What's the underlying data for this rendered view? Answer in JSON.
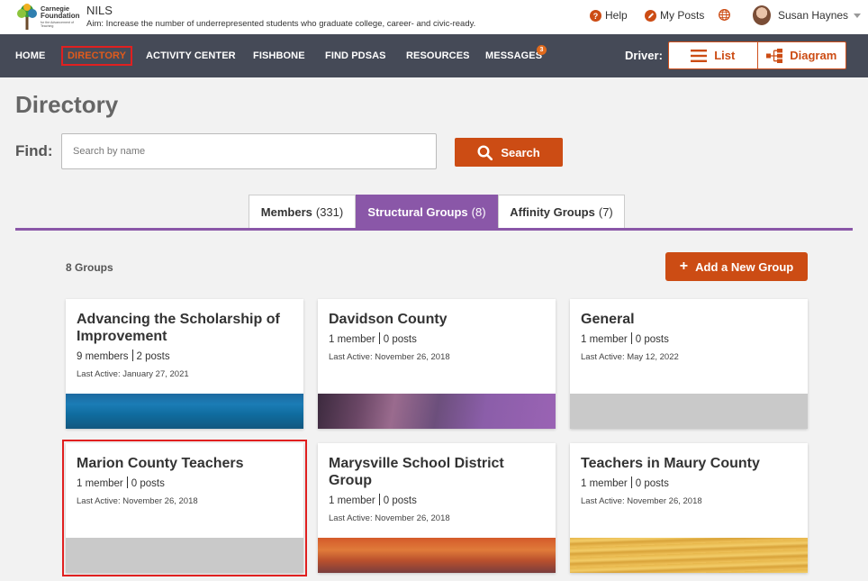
{
  "header": {
    "logo_line1": "Carnegie",
    "logo_line2": "Foundation",
    "logo_line3": "for the Advancement of Teaching",
    "app_name": "NILS",
    "aim": "Aim: Increase the number of underrepresented students who graduate college, career- and civic-ready.",
    "help": "Help",
    "my_posts": "My Posts",
    "user_name": "Susan Haynes"
  },
  "nav": {
    "items": [
      "HOME",
      "DIRECTORY",
      "ACTIVITY CENTER",
      "FISHBONE",
      "FIND PDSAS",
      "RESOURCES",
      "MESSAGES"
    ],
    "active": "DIRECTORY",
    "messages_badge": "3",
    "driver_label": "Driver:",
    "driver_list": "List",
    "driver_diagram": "Diagram"
  },
  "directory": {
    "title": "Directory",
    "find_label": "Find:",
    "search_placeholder": "Search by name",
    "search_value": "",
    "search_button": "Search",
    "tabs": [
      {
        "label": "Members",
        "count": "(331)"
      },
      {
        "label": "Structural Groups",
        "count": "(8)"
      },
      {
        "label": "Affinity Groups",
        "count": "(7)"
      }
    ],
    "active_tab": "Structural Groups",
    "groups_count": "8 Groups",
    "add_group_button": "Add a New Group"
  },
  "groups": [
    {
      "title": "Advancing the Scholarship of Improvement",
      "members": "9 members",
      "posts": "2 posts",
      "last_active": "Last Active: January 27, 2021",
      "image": "blue"
    },
    {
      "title": "Davidson County",
      "members": "1 member",
      "posts": "0 posts",
      "last_active": "Last Active: November 26, 2018",
      "image": "purple"
    },
    {
      "title": "General",
      "members": "1 member",
      "posts": "0 posts",
      "last_active": "Last Active: May 12, 2022",
      "image": "gray"
    },
    {
      "title": "Marion County Teachers",
      "members": "1 member",
      "posts": "0 posts",
      "last_active": "Last Active: November 26, 2018",
      "image": "gray"
    },
    {
      "title": "Marysville School District Group",
      "members": "1 member",
      "posts": "0 posts",
      "last_active": "Last Active: November 26, 2018",
      "image": "orange"
    },
    {
      "title": "Teachers in Maury County",
      "members": "1 member",
      "posts": "0 posts",
      "last_active": "Last Active: November 26, 2018",
      "image": "wood"
    }
  ],
  "colors": {
    "accent_orange": "#cc4c14",
    "nav_bg": "#454a57",
    "tab_purple": "#8a57a8",
    "highlight_red": "#e02020"
  },
  "icons": [
    "help-icon",
    "my-posts-icon",
    "globe-icon",
    "list-icon",
    "diagram-icon",
    "search-icon",
    "plus-icon"
  ]
}
